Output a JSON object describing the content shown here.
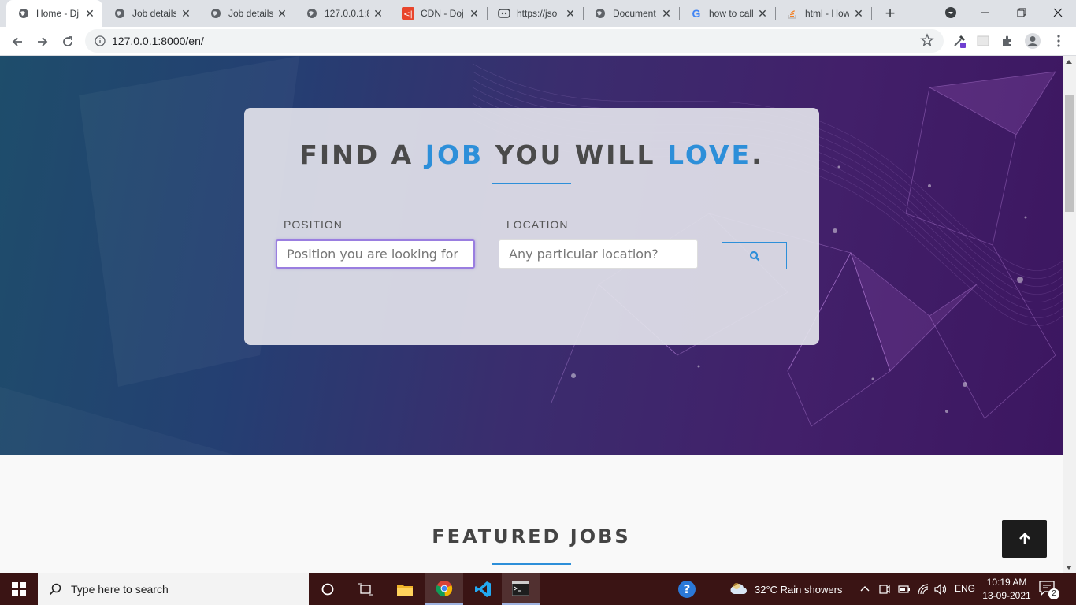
{
  "browser": {
    "tabs": [
      {
        "title": "Home - Dj",
        "icon": "globe-icon",
        "active": true
      },
      {
        "title": "Job details",
        "icon": "globe-icon"
      },
      {
        "title": "Job details",
        "icon": "globe-icon"
      },
      {
        "title": "127.0.0.1:8",
        "icon": "globe-icon"
      },
      {
        "title": "CDN - Doj",
        "icon": "cdn-icon"
      },
      {
        "title": "https://jso",
        "icon": "json-icon"
      },
      {
        "title": "Document",
        "icon": "globe-icon"
      },
      {
        "title": "how to call",
        "icon": "google-icon"
      },
      {
        "title": "html - How",
        "icon": "stackoverflow-icon"
      }
    ],
    "url": "127.0.0.1:8000/en/"
  },
  "hero": {
    "title_part1": "FIND A ",
    "title_accent1": "JOB",
    "title_part2": " YOU WILL ",
    "title_accent2": "LOVE",
    "title_end": ".",
    "position_label": "POSITION",
    "position_placeholder": "Position you are looking for",
    "location_label": "LOCATION",
    "location_placeholder": "Any particular location?"
  },
  "featured": {
    "title": "FEATURED JOBS"
  },
  "taskbar": {
    "search_placeholder": "Type here to search",
    "weather": "32°C  Rain showers",
    "language": "ENG",
    "time": "10:19 AM",
    "date": "13-09-2021",
    "notifications": "2"
  },
  "colors": {
    "accent": "#2d8fd9",
    "title_text": "#4a4a4a",
    "hero_start": "#1e4d6b",
    "hero_end": "#3c1660"
  }
}
